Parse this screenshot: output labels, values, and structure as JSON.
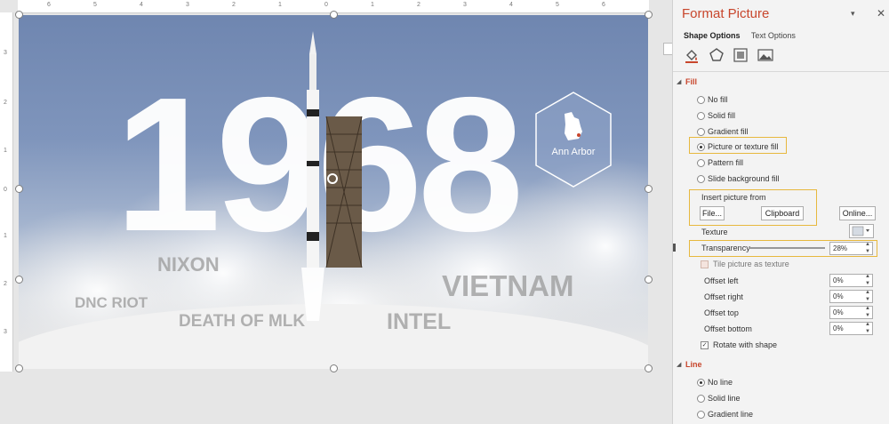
{
  "ruler": {
    "top_numbers": [
      "6",
      "5",
      "4",
      "3",
      "2",
      "1",
      "0",
      "1",
      "2",
      "3",
      "4",
      "5",
      "6"
    ],
    "left_numbers": [
      "3",
      "2",
      "1",
      "0",
      "1",
      "2",
      "3"
    ]
  },
  "slide": {
    "year": "1968",
    "badge_label": "Ann Arbor",
    "words": {
      "nixon": "NIXON",
      "dnc_riot": "DNC RIOT",
      "death_mlk": "DEATH OF MLK",
      "intel": "INTEL",
      "vietnam": "VIETNAM"
    }
  },
  "panel": {
    "title": "Format Picture",
    "pin": "▾",
    "close": "✕",
    "tabs": {
      "shape": "Shape Options",
      "text": "Text Options"
    },
    "icons": [
      "fill-line-icon",
      "effects-icon",
      "size-properties-icon",
      "picture-icon"
    ],
    "fill": {
      "header": "Fill",
      "options": {
        "no_fill": "No fill",
        "solid_fill": "Solid fill",
        "gradient_fill": "Gradient fill",
        "picture_fill": "Picture or texture fill",
        "pattern_fill": "Pattern fill",
        "slide_bg_fill": "Slide background fill"
      },
      "selected": "picture_fill",
      "insert_from": "Insert picture from",
      "file_btn": "File...",
      "clipboard_btn": "Clipboard",
      "online_btn": "Online...",
      "texture_label": "Texture",
      "transparency_label": "Transparency",
      "transparency_value": "28%",
      "transparency_fraction": 0.28,
      "tile_label": "Tile picture as texture",
      "offset_left_label": "Offset left",
      "offset_left": "0%",
      "offset_right_label": "Offset right",
      "offset_right": "0%",
      "offset_top_label": "Offset top",
      "offset_top": "0%",
      "offset_bottom_label": "Offset bottom",
      "offset_bottom": "0%",
      "rotate_label": "Rotate with shape",
      "rotate_checked": "✓"
    },
    "line": {
      "header": "Line",
      "options": {
        "no_line": "No line",
        "solid_line": "Solid line",
        "gradient_line": "Gradient line"
      },
      "selected": "no_line"
    }
  },
  "colors": {
    "accent": "#c8462c",
    "highlight": "#e7b83e"
  }
}
